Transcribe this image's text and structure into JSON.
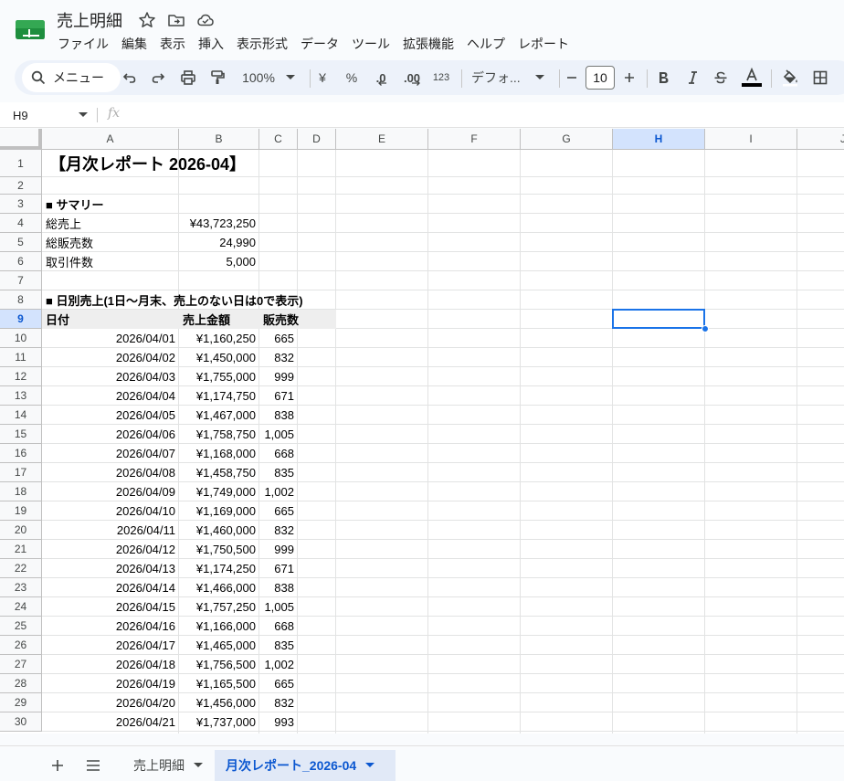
{
  "app": {
    "doc_title": "売上明細",
    "menu": [
      "ファイル",
      "編集",
      "表示",
      "挿入",
      "表示形式",
      "データ",
      "ツール",
      "拡張機能",
      "ヘルプ",
      "レポート"
    ]
  },
  "toolbar": {
    "search_label": "メニュー",
    "zoom": "100%",
    "currency": "¥",
    "percent": "%",
    "decimal_decrease": ".0",
    "decimal_increase": ".00",
    "number_format": "123",
    "font": "デフォ...",
    "font_size": "10"
  },
  "formula_bar": {
    "cell_ref": "H9",
    "fx": "fx"
  },
  "columns": [
    "A",
    "B",
    "C",
    "D",
    "E",
    "F",
    "G",
    "H",
    "I",
    "J"
  ],
  "selected_column": "H",
  "selected_row": 9,
  "row_numbers": [
    1,
    2,
    3,
    4,
    5,
    6,
    7,
    8,
    9,
    10,
    11,
    12,
    13,
    14,
    15,
    16,
    17,
    18,
    19,
    20,
    21,
    22,
    23,
    24,
    25,
    26,
    27,
    28,
    29,
    30
  ],
  "sheet": {
    "title": "【月次レポート 2026-04】",
    "summary_heading": "■ サマリー",
    "summary": [
      {
        "label": "総売上",
        "value": "¥43,723,250"
      },
      {
        "label": "総販売数",
        "value": "24,990"
      },
      {
        "label": "取引件数",
        "value": "5,000"
      }
    ],
    "daily_heading": "■ 日別売上(1日〜月末、売上のない日は0で表示)",
    "table_headers": [
      "日付",
      "売上金額",
      "販売数"
    ],
    "daily_rows": [
      [
        "2026/04/01",
        "¥1,160,250",
        "665"
      ],
      [
        "2026/04/02",
        "¥1,450,000",
        "832"
      ],
      [
        "2026/04/03",
        "¥1,755,000",
        "999"
      ],
      [
        "2026/04/04",
        "¥1,174,750",
        "671"
      ],
      [
        "2026/04/05",
        "¥1,467,000",
        "838"
      ],
      [
        "2026/04/06",
        "¥1,758,750",
        "1,005"
      ],
      [
        "2026/04/07",
        "¥1,168,000",
        "668"
      ],
      [
        "2026/04/08",
        "¥1,458,750",
        "835"
      ],
      [
        "2026/04/09",
        "¥1,749,000",
        "1,002"
      ],
      [
        "2026/04/10",
        "¥1,169,000",
        "665"
      ],
      [
        "2026/04/11",
        "¥1,460,000",
        "832"
      ],
      [
        "2026/04/12",
        "¥1,750,500",
        "999"
      ],
      [
        "2026/04/13",
        "¥1,174,250",
        "671"
      ],
      [
        "2026/04/14",
        "¥1,466,000",
        "838"
      ],
      [
        "2026/04/15",
        "¥1,757,250",
        "1,005"
      ],
      [
        "2026/04/16",
        "¥1,166,000",
        "668"
      ],
      [
        "2026/04/17",
        "¥1,465,000",
        "835"
      ],
      [
        "2026/04/18",
        "¥1,756,500",
        "1,002"
      ],
      [
        "2026/04/19",
        "¥1,165,500",
        "665"
      ],
      [
        "2026/04/20",
        "¥1,456,000",
        "832"
      ],
      [
        "2026/04/21",
        "¥1,737,000",
        "993"
      ]
    ]
  },
  "tabs": [
    {
      "label": "売上明細",
      "active": false
    },
    {
      "label": "月次レポート_2026-04",
      "active": true
    }
  ],
  "colors": {
    "accent": "#0b57d0",
    "selection": "#1a73e8",
    "toolbar_bg": "#edf2fa",
    "header_selected": "#d3e3fd"
  }
}
